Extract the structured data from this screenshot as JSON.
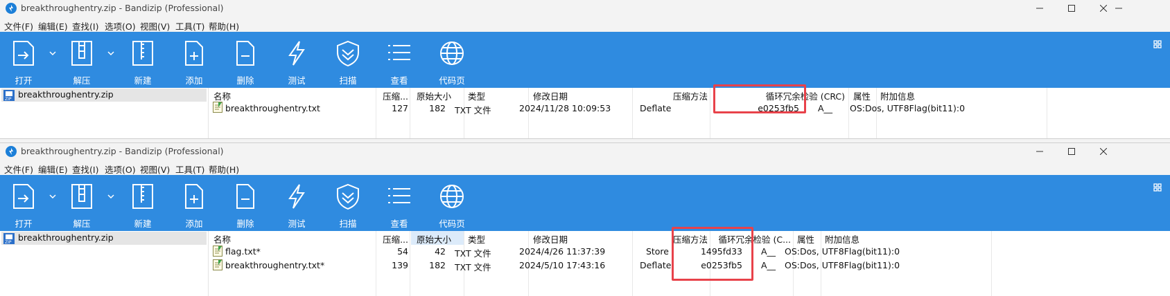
{
  "window1": {
    "title": "breakthroughentry.zip - Bandizip (Professional)",
    "tree_item": "breakthroughentry.zip",
    "headers": {
      "name": "名称",
      "compressed": "压缩...",
      "original": "原始大小",
      "type": "类型",
      "modified": "修改日期",
      "method": "压缩方法",
      "crc": "循环冗余检验 (CRC)",
      "attr": "属性",
      "extra": "附加信息"
    },
    "rows": [
      {
        "name": "breakthroughentry.txt",
        "compressed": "127",
        "original": "182",
        "type": "TXT 文件",
        "modified": "2024/11/28 10:09:53",
        "method": "Deflate",
        "crc": "e0253fb5",
        "attr": "A__",
        "extra": "OS:Dos, UTF8Flag(bit11):0"
      }
    ]
  },
  "window2": {
    "title": "breakthroughentry.zip - Bandizip (Professional)",
    "tree_item": "breakthroughentry.zip",
    "headers": {
      "name": "名称",
      "compressed": "压缩...",
      "original": "原始大小",
      "type": "类型",
      "modified": "修改日期",
      "method": "压缩方法",
      "crc": "循环冗余检验 (C...",
      "attr": "属性",
      "extra": "附加信息"
    },
    "rows": [
      {
        "name": "flag.txt*",
        "compressed": "54",
        "original": "42",
        "type": "TXT 文件",
        "modified": "2024/4/26 11:37:39",
        "method": "Store",
        "crc": "1495fd33",
        "attr": "A__",
        "extra": "OS:Dos, UTF8Flag(bit11):0"
      },
      {
        "name": "breakthroughentry.txt*",
        "compressed": "139",
        "original": "182",
        "type": "TXT 文件",
        "modified": "2024/5/10 17:43:16",
        "method": "Deflate",
        "crc": "e0253fb5",
        "attr": "A__",
        "extra": "OS:Dos, UTF8Flag(bit11):0"
      }
    ]
  },
  "menus": [
    "文件(F)",
    "编辑(E)",
    "查找(I)",
    "选项(O)",
    "视图(V)",
    "工具(T)",
    "帮助(H)"
  ],
  "toolbar": {
    "open": "打开",
    "extract": "解压",
    "new": "新建",
    "add": "添加",
    "delete": "删除",
    "test": "测试",
    "scan": "扫描",
    "view": "查看",
    "codepage": "代码页"
  },
  "icons": {
    "app": "bandizip-logo-icon",
    "zip": "zip-archive-icon",
    "file": "text-file-icon",
    "grid": "grid-view-icon"
  },
  "colors": {
    "toolbar_bg": "#2f8be0",
    "highlight_box": "#e8424a",
    "selected_tree": "#e5e5e5",
    "sorted_column": "#dcebfa"
  }
}
